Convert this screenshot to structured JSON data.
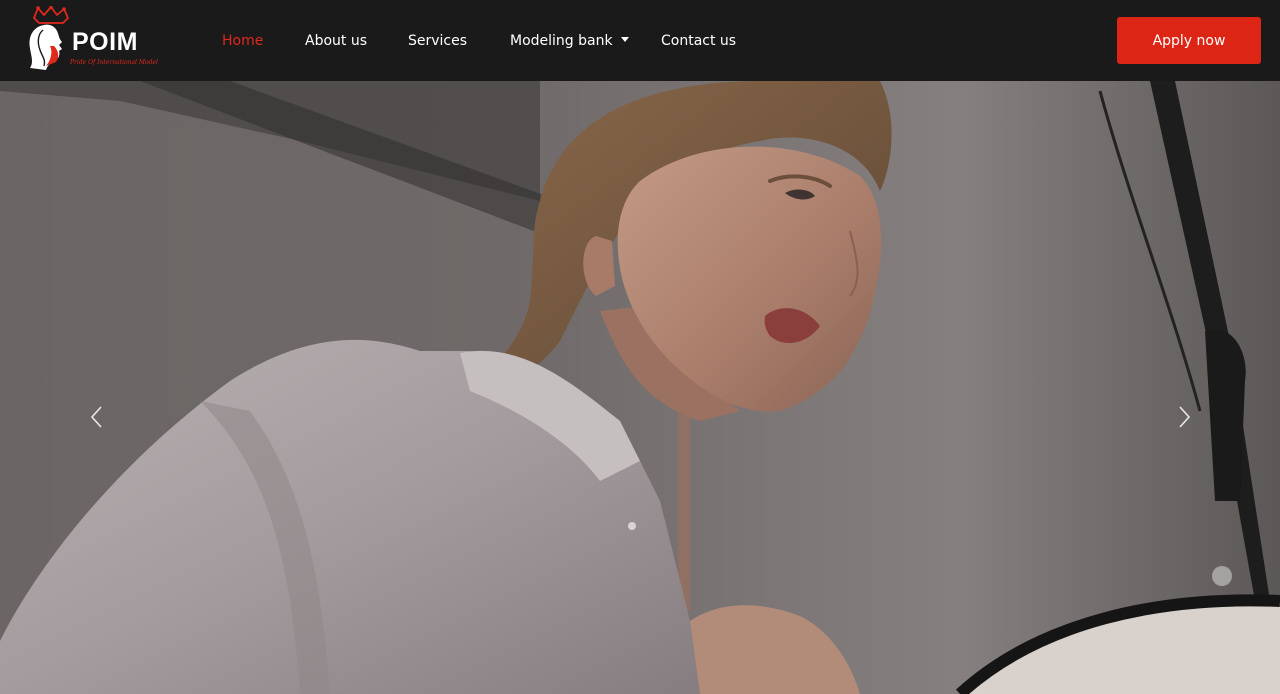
{
  "brand": {
    "name": "POIM",
    "tagline": "Pride Of International Model"
  },
  "nav": {
    "items": [
      {
        "label": "Home",
        "active": true
      },
      {
        "label": "About us",
        "active": false
      },
      {
        "label": "Services",
        "active": false
      },
      {
        "label": "Modeling bank",
        "active": false,
        "has_dropdown": true
      },
      {
        "label": "Contact us",
        "active": false
      }
    ],
    "cta_label": "Apply now"
  },
  "hero": {
    "prev_icon": "chevron-left-icon",
    "next_icon": "chevron-right-icon"
  },
  "colors": {
    "accent": "#dd2516",
    "active_link": "#e0281c",
    "navbar_bg": "#1a1a1a"
  }
}
